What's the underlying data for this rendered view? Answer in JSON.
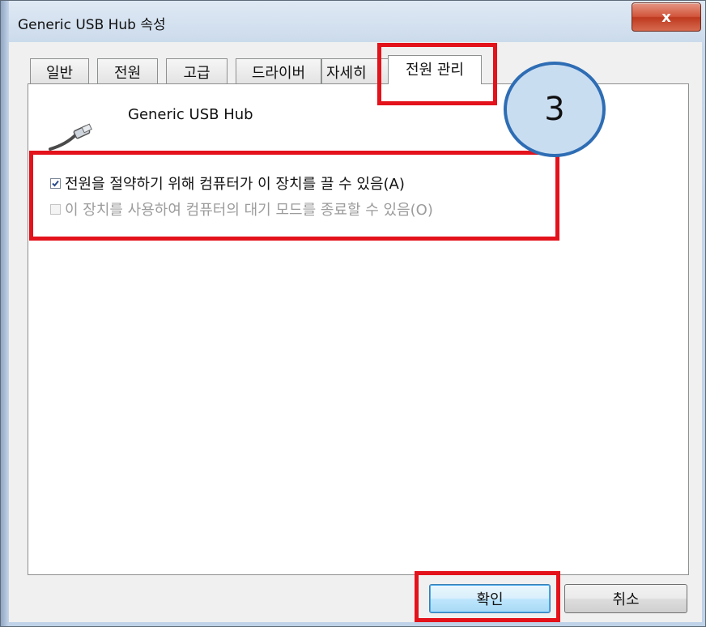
{
  "window": {
    "title": "Generic USB Hub 속성",
    "close_label": "x"
  },
  "tabs": [
    {
      "label": "일반"
    },
    {
      "label": "전원"
    },
    {
      "label": "고급"
    },
    {
      "label": "드라이버"
    },
    {
      "label": "자세히"
    },
    {
      "label": "전원 관리",
      "active": true
    }
  ],
  "device": {
    "name": "Generic USB Hub",
    "icon": "usb-cable-icon"
  },
  "options": {
    "allow_turn_off": {
      "label": "전원을 절약하기 위해 컴퓨터가 이 장치를 끌 수 있음(A)",
      "checked": true,
      "enabled": true
    },
    "allow_wake": {
      "label": "이 장치를 사용하여 컴퓨터의 대기 모드를 종료할 수 있음(O)",
      "checked": false,
      "enabled": false
    }
  },
  "annotation": {
    "step_number": "3",
    "highlight_color": "#e3121b",
    "badge_fill": "#c9ddf1",
    "badge_border": "#2e6db4"
  },
  "buttons": {
    "ok": "확인",
    "cancel": "취소"
  }
}
